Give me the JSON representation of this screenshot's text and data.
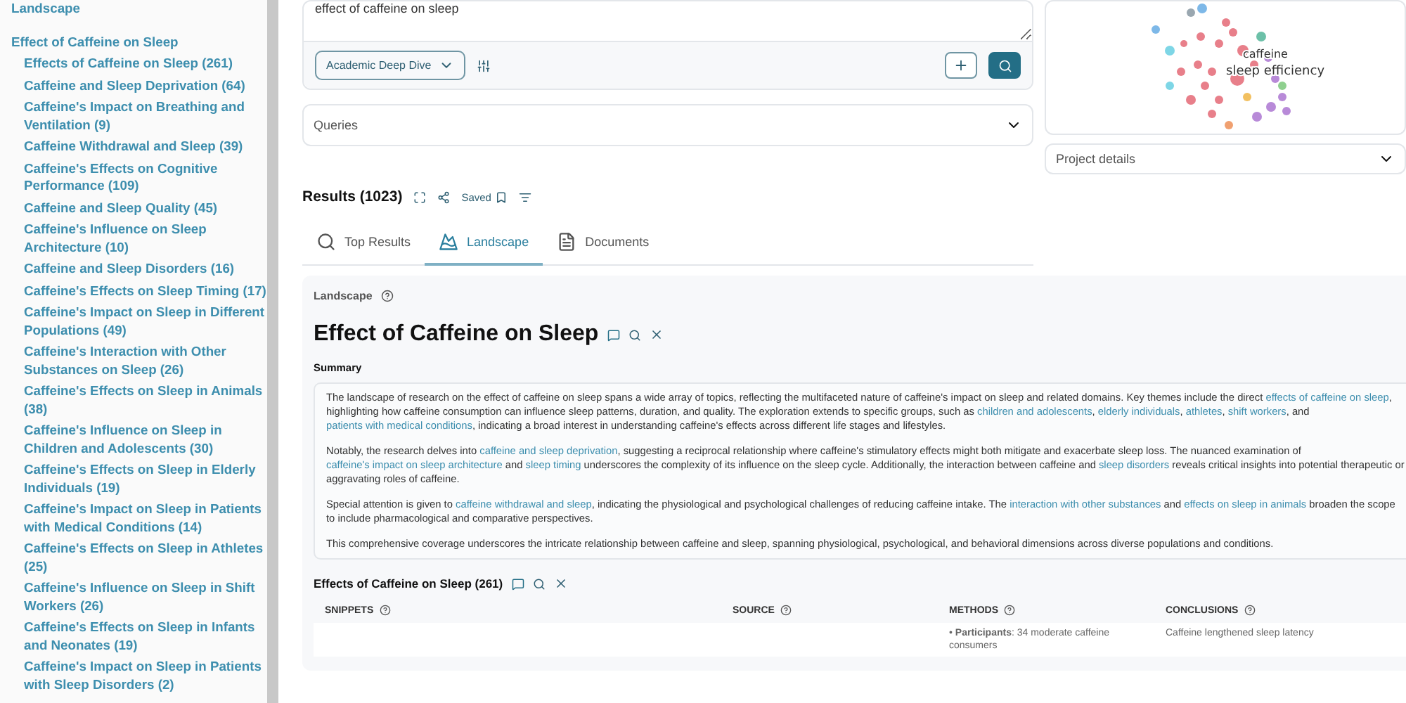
{
  "sidebar": {
    "items": [
      {
        "label": "Landscape",
        "selected": false
      },
      {
        "label": "Effect of Caffeine on Sleep",
        "selected": false,
        "children": [
          {
            "label": "Effects of Caffeine on Sleep (261)"
          },
          {
            "label": "Caffeine and Sleep Deprivation (64)"
          },
          {
            "label": "Caffeine's Impact on Breathing and Ventilation (9)"
          },
          {
            "label": "Caffeine Withdrawal and Sleep (39)"
          },
          {
            "label": "Caffeine's Effects on Cognitive Performance (109)"
          },
          {
            "label": "Caffeine and Sleep Quality (45)"
          },
          {
            "label": "Caffeine's Influence on Sleep Architecture (10)"
          },
          {
            "label": "Caffeine and Sleep Disorders (16)"
          },
          {
            "label": "Caffeine's Effects on Sleep Timing (17)"
          },
          {
            "label": "Caffeine's Impact on Sleep in Different Populations (49)"
          },
          {
            "label": "Caffeine's Interaction with Other Substances on Sleep (26)"
          },
          {
            "label": "Caffeine's Effects on Sleep in Animals (38)"
          },
          {
            "label": "Caffeine's Influence on Sleep in Children and Adolescents (30)"
          },
          {
            "label": "Caffeine's Effects on Sleep in Elderly Individuals (19)"
          },
          {
            "label": "Caffeine's Impact on Sleep in Patients with Medical Conditions (14)"
          },
          {
            "label": "Caffeine's Effects on Sleep in Athletes (25)"
          },
          {
            "label": "Caffeine's Influence on Sleep in Shift Workers (26)"
          },
          {
            "label": "Caffeine's Effects on Sleep in Infants and Neonates (19)"
          },
          {
            "label": "Caffeine's Impact on Sleep in Patients with Sleep Disorders (2)"
          }
        ]
      }
    ]
  },
  "search": {
    "value": "effect of caffeine on sleep",
    "mode": "Academic Deep Dive"
  },
  "queries": {
    "label": "Queries"
  },
  "graph": {
    "labels": [
      "caffeine",
      "sleep efficiency"
    ]
  },
  "project_details": {
    "label": "Project details"
  },
  "results": {
    "title": "Results (1023)",
    "saved": "Saved"
  },
  "tabs": [
    {
      "label": "Top Results",
      "kind": "search",
      "selected": false
    },
    {
      "label": "Landscape",
      "kind": "landscape",
      "selected": true
    },
    {
      "label": "Documents",
      "kind": "document",
      "selected": false
    }
  ],
  "landscape": {
    "label": "Landscape",
    "title": "Effect of Caffeine on Sleep",
    "summary_label": "Summary",
    "summary": [
      [
        {
          "kind": "text",
          "text": "The landscape of research on the effect of caffeine on sleep spans a wide array of topics, reflecting the multifaceted nature of caffeine's impact on sleep and related domains. Key themes include the direct "
        },
        {
          "kind": "link",
          "text": "effects of caffeine on sleep"
        },
        {
          "kind": "text",
          "text": ", highlighting how caffeine consumption can influence sleep patterns, duration, and quality. The exploration extends to specific groups, such as "
        },
        {
          "kind": "link",
          "text": "children and adolescents"
        },
        {
          "kind": "text",
          "text": ", "
        },
        {
          "kind": "link",
          "text": "elderly individuals"
        },
        {
          "kind": "text",
          "text": ", "
        },
        {
          "kind": "link",
          "text": "athletes"
        },
        {
          "kind": "text",
          "text": ", "
        },
        {
          "kind": "link",
          "text": "shift workers"
        },
        {
          "kind": "text",
          "text": ", and "
        },
        {
          "kind": "link",
          "text": "patients with medical conditions"
        },
        {
          "kind": "text",
          "text": ", indicating a broad interest in understanding caffeine's effects across different life stages and lifestyles."
        }
      ],
      [
        {
          "kind": "text",
          "text": "Notably, the research delves into "
        },
        {
          "kind": "link",
          "text": "caffeine and sleep deprivation"
        },
        {
          "kind": "text",
          "text": ", suggesting a reciprocal relationship where caffeine's stimulatory effects might both mitigate and exacerbate sleep loss. The nuanced examination of "
        },
        {
          "kind": "link",
          "text": "caffeine's impact on sleep architecture"
        },
        {
          "kind": "text",
          "text": " and "
        },
        {
          "kind": "link",
          "text": "sleep timing"
        },
        {
          "kind": "text",
          "text": " underscores the complexity of its influence on the sleep cycle. Additionally, the interaction between caffeine and "
        },
        {
          "kind": "link",
          "text": "sleep disorders"
        },
        {
          "kind": "text",
          "text": " reveals critical insights into potential therapeutic or aggravating roles of caffeine."
        }
      ],
      [
        {
          "kind": "text",
          "text": "Special attention is given to "
        },
        {
          "kind": "link",
          "text": "caffeine withdrawal and sleep"
        },
        {
          "kind": "text",
          "text": ", indicating the physiological and psychological challenges of reducing caffeine intake. The "
        },
        {
          "kind": "link",
          "text": "interaction with other substances"
        },
        {
          "kind": "text",
          "text": " and "
        },
        {
          "kind": "link",
          "text": "effects on sleep in animals"
        },
        {
          "kind": "text",
          "text": " broaden the scope to include pharmacological and comparative perspectives."
        }
      ],
      [
        {
          "kind": "text",
          "text": "This comprehensive coverage underscores the intricate relationship between caffeine and sleep, spanning physiological, psychological, and behavioral dimensions across diverse populations and conditions."
        }
      ]
    ]
  },
  "topic": {
    "title": "Effects of Caffeine on Sleep (261)",
    "columns": [
      "SNIPPETS",
      "SOURCE",
      "METHODS",
      "CONCLUSIONS"
    ],
    "rows": [
      {
        "methods": {
          "marker": "•",
          "text": "**Participants**: 34 moderate caffeine consumers"
        },
        "conclusions": "Caffeine lengthened sleep latency"
      }
    ]
  }
}
